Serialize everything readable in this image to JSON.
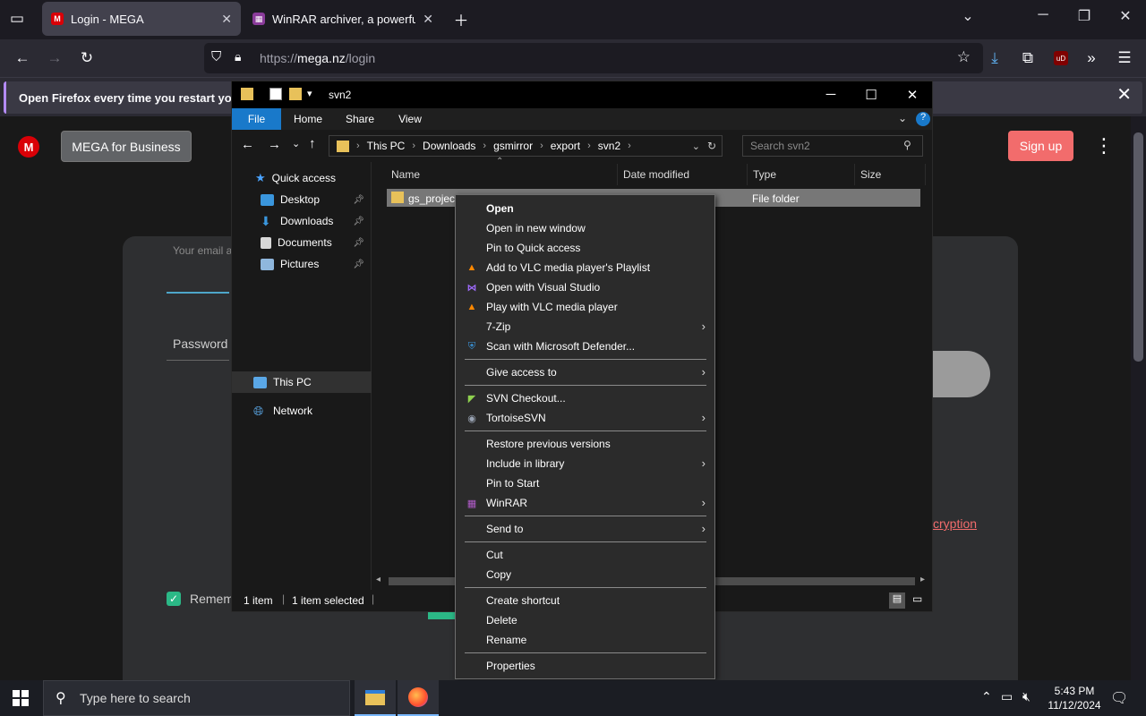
{
  "browser": {
    "tabs": [
      {
        "title": "Login - MEGA",
        "active": true,
        "favicon_color": "#d90007"
      },
      {
        "title": "WinRAR archiver, a powerful to",
        "active": false,
        "favicon_color": "#8a3b9a"
      }
    ],
    "url_prefix": "https://",
    "url_host": "mega.nz",
    "url_path": "/login",
    "notification": "Open Firefox every time you restart your co"
  },
  "page": {
    "logo_letter": "M",
    "business_button": "MEGA for Business",
    "signup_button": "Sign up",
    "email_label": "Your email a",
    "password_label": "Password",
    "remember_label": "Remem",
    "encryption_link": "cryption"
  },
  "explorer": {
    "title": "svn2",
    "ribbon_tabs": [
      "File",
      "Home",
      "Share",
      "View"
    ],
    "path": [
      "This PC",
      "Downloads",
      "gsmirror",
      "export",
      "svn2"
    ],
    "search_placeholder": "Search svn2",
    "nav": [
      {
        "label": "Quick access",
        "icon": "star-icon",
        "pinned": false
      },
      {
        "label": "Desktop",
        "icon": "desktop-icon",
        "pinned": true
      },
      {
        "label": "Downloads",
        "icon": "download-icon",
        "pinned": true
      },
      {
        "label": "Documents",
        "icon": "document-icon",
        "pinned": true
      },
      {
        "label": "Pictures",
        "icon": "pictures-icon",
        "pinned": true
      },
      {
        "label": "This PC",
        "icon": "pc-icon",
        "pinned": false
      },
      {
        "label": "Network",
        "icon": "network-icon",
        "pinned": false
      }
    ],
    "columns": [
      "Name",
      "Date modified",
      "Type",
      "Size"
    ],
    "file": {
      "name": "gs_project",
      "type": "File folder"
    },
    "status_items": "1 item",
    "status_selected": "1 item selected"
  },
  "context_menu": {
    "items": [
      {
        "label": "Open",
        "bold": true,
        "icon": "",
        "submenu": false
      },
      {
        "label": "Open in new window",
        "icon": "",
        "submenu": false
      },
      {
        "label": "Pin to Quick access",
        "icon": "",
        "submenu": false
      },
      {
        "label": "Add to VLC media player's Playlist",
        "icon": "vlc-icon",
        "submenu": false
      },
      {
        "label": "Open with Visual Studio",
        "icon": "visual-studio-icon",
        "submenu": false
      },
      {
        "label": "Play with VLC media player",
        "icon": "vlc-icon",
        "submenu": false
      },
      {
        "label": "7-Zip",
        "icon": "",
        "submenu": true
      },
      {
        "label": "Scan with Microsoft Defender...",
        "icon": "defender-icon",
        "submenu": false
      },
      {
        "separator": true
      },
      {
        "label": "Give access to",
        "icon": "",
        "submenu": true
      },
      {
        "separator": true
      },
      {
        "label": "SVN Checkout...",
        "icon": "svn-checkout-icon",
        "submenu": false
      },
      {
        "label": "TortoiseSVN",
        "icon": "tortoisesvn-icon",
        "submenu": true
      },
      {
        "separator": true
      },
      {
        "label": "Restore previous versions",
        "icon": "",
        "submenu": false
      },
      {
        "label": "Include in library",
        "icon": "",
        "submenu": true
      },
      {
        "label": "Pin to Start",
        "icon": "",
        "submenu": false
      },
      {
        "label": "WinRAR",
        "icon": "winrar-icon",
        "submenu": true
      },
      {
        "separator": true
      },
      {
        "label": "Send to",
        "icon": "",
        "submenu": true
      },
      {
        "separator": true
      },
      {
        "label": "Cut",
        "icon": "",
        "submenu": false
      },
      {
        "label": "Copy",
        "icon": "",
        "submenu": false
      },
      {
        "separator": true
      },
      {
        "label": "Create shortcut",
        "icon": "",
        "submenu": false
      },
      {
        "label": "Delete",
        "icon": "",
        "submenu": false
      },
      {
        "label": "Rename",
        "icon": "",
        "submenu": false
      },
      {
        "separator": true
      },
      {
        "label": "Properties",
        "icon": "",
        "submenu": false
      }
    ]
  },
  "taskbar": {
    "search_placeholder": "Type here to search",
    "time": "5:43 PM",
    "date": "11/12/2024"
  }
}
